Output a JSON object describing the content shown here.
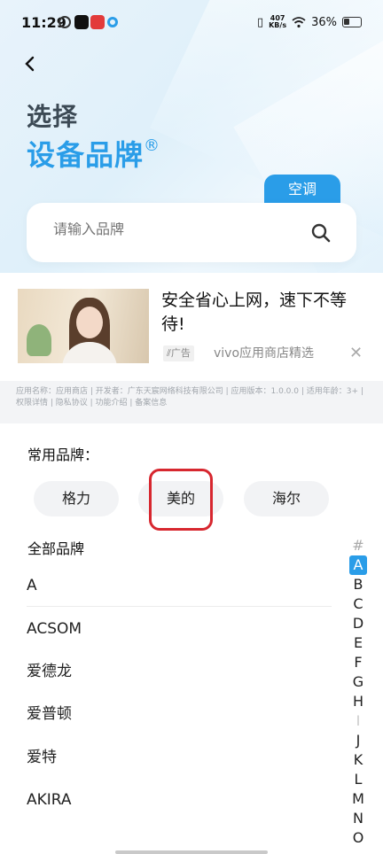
{
  "status_bar": {
    "time": "11:29",
    "net_speed_value": "407",
    "net_speed_unit": "KB/s",
    "battery": "36%"
  },
  "header": {
    "title_line1": "选择",
    "title_line2": "设备品牌",
    "registered_mark": "®",
    "category_tab": "空调"
  },
  "search": {
    "placeholder": "请输入品牌"
  },
  "ad": {
    "title": "安全省心上网，速下不等待!",
    "tag": "广告",
    "source": "vivo应用商店精选",
    "close": "✕"
  },
  "app_info": "应用名称：应用商店 | 开发者：广东天宸网络科技有限公司 | 应用版本：1.0.0.0 | 适用年龄：3+ | 权限详情 | 隐私协议 | 功能介绍 | 备案信息",
  "common_brands": {
    "label": "常用品牌：",
    "items": [
      "格力",
      "美的",
      "海尔"
    ]
  },
  "all_brands": {
    "label": "全部品牌",
    "items": [
      "A",
      "ACSOM",
      "爱德龙",
      "爱普顿",
      "爱特",
      "AKIRA"
    ]
  },
  "index_letters": [
    "#",
    "A",
    "B",
    "C",
    "D",
    "E",
    "F",
    "G",
    "H",
    "I",
    "J",
    "K",
    "L",
    "M",
    "N",
    "O"
  ],
  "index_active": "A",
  "colors": {
    "accent": "#2a9de8",
    "highlight_box": "#d7272f"
  }
}
